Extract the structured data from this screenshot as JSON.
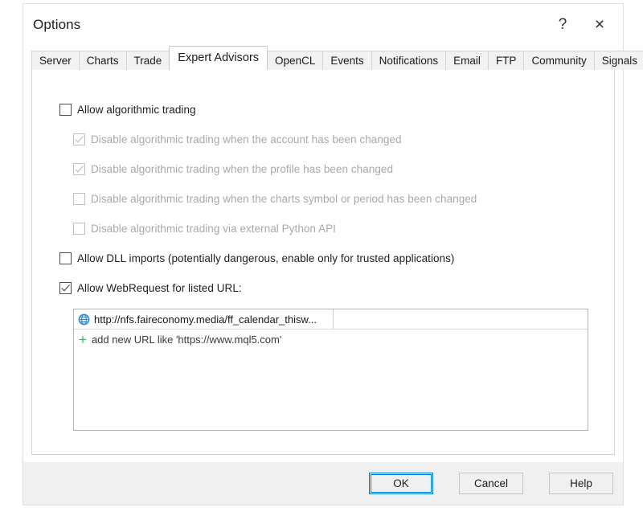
{
  "dialog": {
    "title": "Options",
    "help_button": "?",
    "close_button": "×",
    "help_icon_name": "help-icon",
    "close_icon_name": "close-icon"
  },
  "tabs": [
    {
      "label": "Server",
      "active": false
    },
    {
      "label": "Charts",
      "active": false
    },
    {
      "label": "Trade",
      "active": false
    },
    {
      "label": "Expert Advisors",
      "active": true
    },
    {
      "label": "OpenCL",
      "active": false
    },
    {
      "label": "Events",
      "active": false
    },
    {
      "label": "Notifications",
      "active": false
    },
    {
      "label": "Email",
      "active": false
    },
    {
      "label": "FTP",
      "active": false
    },
    {
      "label": "Community",
      "active": false
    },
    {
      "label": "Signals",
      "active": false
    }
  ],
  "options": [
    {
      "label": "Allow algorithmic trading",
      "checked": false,
      "disabled": false,
      "indent": false
    },
    {
      "label": "Disable algorithmic trading when the account has been changed",
      "checked": true,
      "disabled": true,
      "indent": true
    },
    {
      "label": "Disable algorithmic trading when the profile has been changed",
      "checked": true,
      "disabled": true,
      "indent": true
    },
    {
      "label": "Disable algorithmic trading when the charts symbol or period has been changed",
      "checked": false,
      "disabled": true,
      "indent": true
    },
    {
      "label": "Disable algorithmic trading via external Python API",
      "checked": false,
      "disabled": true,
      "indent": true
    },
    {
      "label": "Allow DLL imports (potentially dangerous, enable only for trusted applications)",
      "checked": false,
      "disabled": false,
      "indent": false
    },
    {
      "label": "Allow WebRequest for listed URL:",
      "checked": true,
      "disabled": false,
      "indent": false
    }
  ],
  "url_list": {
    "entries": [
      {
        "url": "http://nfs.faireconomy.media/ff_calendar_thisw...",
        "icon": "globe-icon"
      }
    ],
    "add_row": {
      "plus": "+",
      "text": "add new URL like 'https://www.mql5.com'"
    }
  },
  "footer": {
    "ok": "OK",
    "cancel": "Cancel",
    "help": "Help"
  },
  "colors": {
    "accent": "#0078d7",
    "globe": "#2f86c5",
    "plus": "#3faa55",
    "disabled_text": "#a9a9a9",
    "footer_bg": "#f0f0f0"
  }
}
